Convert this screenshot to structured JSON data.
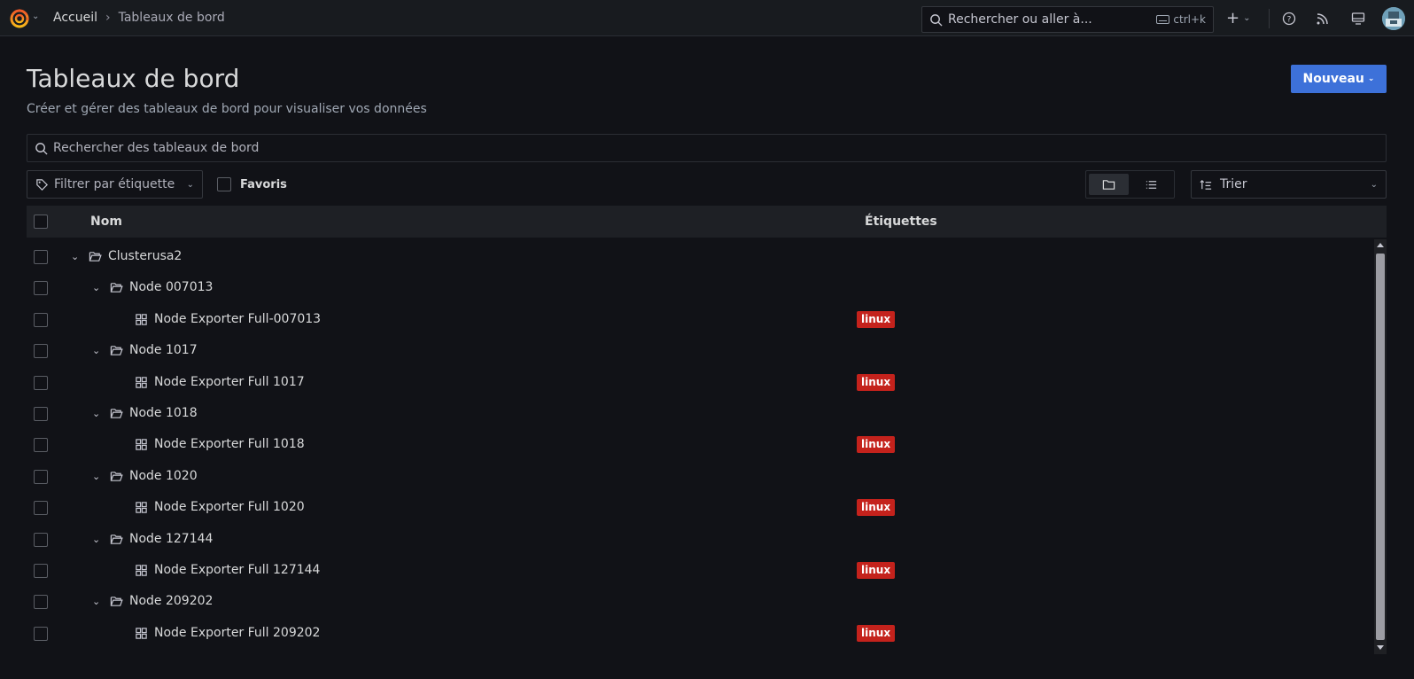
{
  "header": {
    "breadcrumb": {
      "home": "Accueil",
      "separator": "›",
      "current": "Tableaux de bord"
    },
    "search": {
      "placeholder": "Rechercher ou aller à...",
      "shortcut": "ctrl+k"
    },
    "icons": [
      "grafana-logo-icon",
      "plus-icon",
      "help-icon",
      "news-rss-icon",
      "kiosk-monitor-icon",
      "user-avatar"
    ]
  },
  "page": {
    "title": "Tableaux de bord",
    "subtitle": "Créer et gérer des tableaux de bord pour visualiser vos données",
    "new_button": "Nouveau"
  },
  "filters": {
    "search_placeholder": "Rechercher des tableaux de bord",
    "tag_filter_placeholder": "Filtrer par étiquette",
    "favorites_label": "Favoris",
    "sort_placeholder": "Trier",
    "view_modes": [
      "folder-view",
      "list-view"
    ],
    "active_view": "folder-view"
  },
  "table": {
    "columns": {
      "name": "Nom",
      "tags": "Étiquettes"
    },
    "rows": [
      {
        "type": "folder",
        "depth": 0,
        "name": "Clusterusa2",
        "tag": ""
      },
      {
        "type": "folder",
        "depth": 1,
        "name": "Node 007013",
        "tag": ""
      },
      {
        "type": "dashboard",
        "depth": 2,
        "name": "Node Exporter Full-007013",
        "tag": "linux"
      },
      {
        "type": "folder",
        "depth": 1,
        "name": "Node 1017",
        "tag": ""
      },
      {
        "type": "dashboard",
        "depth": 2,
        "name": "Node Exporter Full 1017",
        "tag": "linux"
      },
      {
        "type": "folder",
        "depth": 1,
        "name": "Node 1018",
        "tag": ""
      },
      {
        "type": "dashboard",
        "depth": 2,
        "name": "Node Exporter Full 1018",
        "tag": "linux"
      },
      {
        "type": "folder",
        "depth": 1,
        "name": "Node 1020",
        "tag": ""
      },
      {
        "type": "dashboard",
        "depth": 2,
        "name": "Node Exporter Full 1020",
        "tag": "linux"
      },
      {
        "type": "folder",
        "depth": 1,
        "name": "Node 127144",
        "tag": ""
      },
      {
        "type": "dashboard",
        "depth": 2,
        "name": "Node Exporter Full 127144",
        "tag": "linux"
      },
      {
        "type": "folder",
        "depth": 1,
        "name": "Node 209202",
        "tag": ""
      },
      {
        "type": "dashboard",
        "depth": 2,
        "name": "Node Exporter Full 209202",
        "tag": "linux"
      }
    ]
  },
  "colors": {
    "accent": "#3d71d9",
    "tag_linux": "#c4221c",
    "background": "#111217",
    "panel": "#181b1f"
  }
}
